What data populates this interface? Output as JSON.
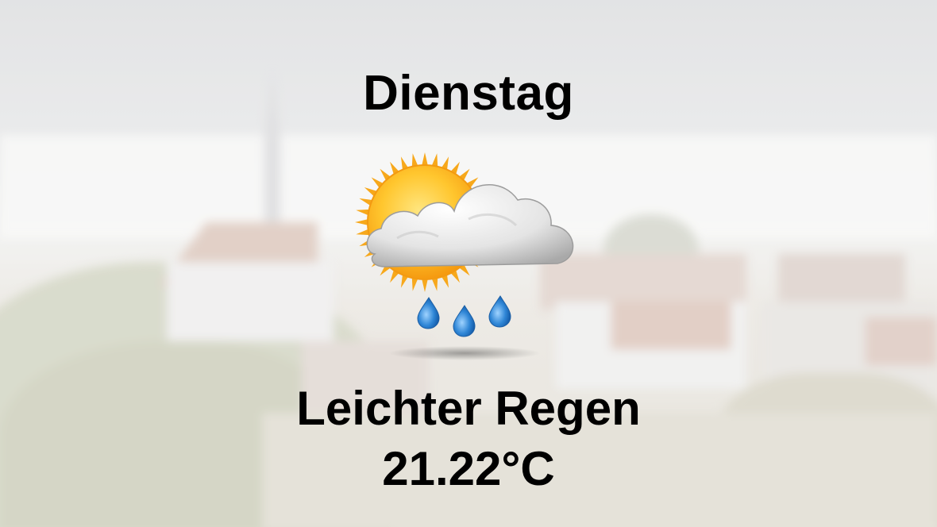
{
  "forecast": {
    "day": "Dienstag",
    "icon": "partly-sunny-light-rain-icon",
    "condition": "Leichter Regen",
    "temperature": "21.22°C"
  },
  "colors": {
    "text": "#000000",
    "sun": "#f7a81b",
    "sun_core": "#ffd54a",
    "cloud": "#e8e8e8",
    "rain": "#2f86d6"
  }
}
